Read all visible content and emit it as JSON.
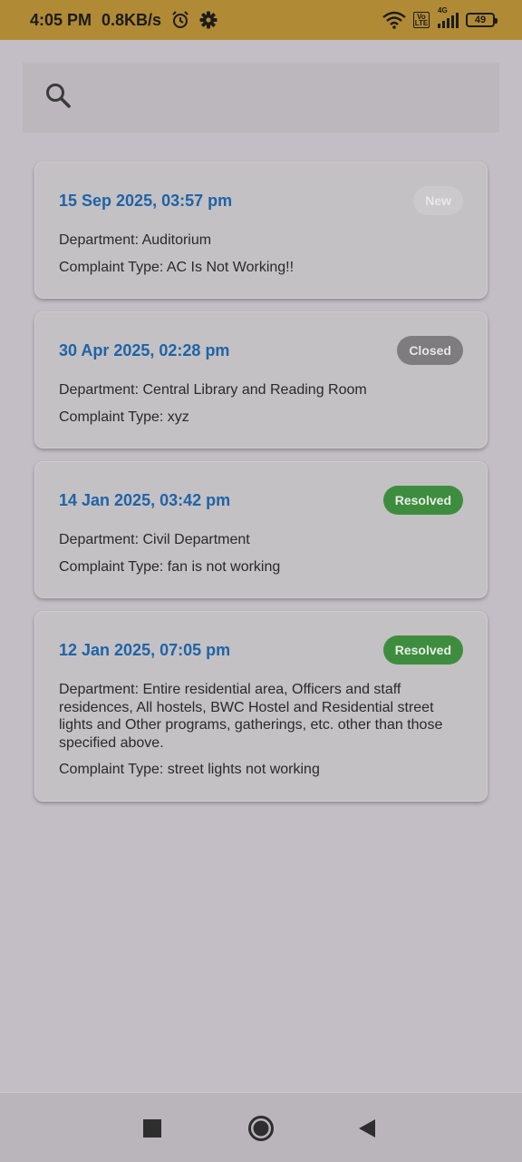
{
  "status_bar": {
    "time": "4:05 PM",
    "speed": "0.8KB/s",
    "alarm_icon": "alarm-clock-icon",
    "settings_icon": "gear-icon",
    "wifi_icon": "wifi-icon",
    "volte_label_top": "Vo",
    "volte_label_bottom": "LTE",
    "network_label": "4G",
    "battery": "49"
  },
  "search": {
    "icon": "search-icon",
    "placeholder": ""
  },
  "complaints": [
    {
      "date": "15 Sep 2025, 03:57 pm",
      "status": "New",
      "department": "Department: Auditorium",
      "type": "Complaint Type: AC Is Not Working!!"
    },
    {
      "date": "30 Apr 2025, 02:28 pm",
      "status": "Closed",
      "department": "Department: Central Library and Reading Room",
      "type": "Complaint Type: xyz"
    },
    {
      "date": "14 Jan 2025, 03:42 pm",
      "status": "Resolved",
      "department": "Department: Civil Department",
      "type": "Complaint Type: fan is not working"
    },
    {
      "date": "12 Jan 2025, 07:05 pm",
      "status": "Resolved",
      "department": "Department: Entire residential area, Officers and staff residences, All hostels, BWC Hostel and Residential street lights and Other programs, gatherings, etc. other than those specified above.",
      "type": "Complaint Type: street lights not working"
    }
  ],
  "colors": {
    "status_bar": "#b08a35",
    "date_text": "#1f63a8",
    "resolved": "#3e8d3f",
    "closed": "#7e7c7e",
    "new": "#cbc9cb"
  },
  "nav": {
    "recents_icon": "square-icon",
    "home_icon": "circle-icon",
    "back_icon": "back-triangle-icon"
  }
}
